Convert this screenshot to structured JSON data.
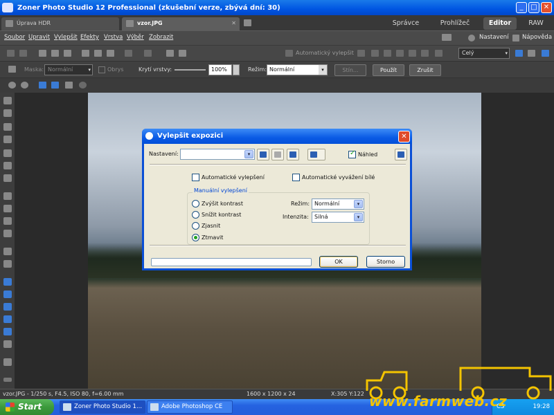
{
  "window": {
    "title": "Zoner Photo Studio 12 Professional (zkušební verze, zbývá dní: 30)",
    "minimize": "_",
    "maximize": "□",
    "close": "✕"
  },
  "tabs": [
    {
      "label": "Úprava HDR"
    },
    {
      "label": "vzor.JPG",
      "close": "✕"
    }
  ],
  "modes": {
    "manager": "Správce",
    "viewer": "Prohlížeč",
    "editor": "Editor",
    "raw": "RAW"
  },
  "menu": {
    "items": [
      "Soubor",
      "Upravit",
      "Vylepšit",
      "Efekty",
      "Vrstva",
      "Výběr",
      "Zobrazit"
    ],
    "settings": "Nastavení",
    "help": "Nápověda"
  },
  "toolbar1": {
    "auto_improve": "Automatický vylepšit",
    "zoom_select": "Celý",
    "zoom_arrow": "▾"
  },
  "toolbar2": {
    "mask_label": "Maska:",
    "mask_value": "Normální",
    "frame_label": "Obrys",
    "opacity_label": "Krytí vrstvy:",
    "opacity_value": "100%",
    "mode_label": "Režim:",
    "mode_value": "Normální",
    "shadow_btn": "Stín...",
    "apply_btn": "Použít",
    "cancel_btn": "Zrušit"
  },
  "dialog": {
    "title": "Vylepšit expozici",
    "close": "✕",
    "settings_label": "Nastavení:",
    "settings_value": "",
    "preview_label": "Náhled",
    "preview_checked": true,
    "auto_improve_label": "Automatické vylepšení",
    "auto_improve_checked": false,
    "auto_white_label": "Automatické vyvážení bílé",
    "auto_white_checked": false,
    "manual_group": "Manuální vylepšení",
    "radios": [
      {
        "label": "Zvýšit kontrast",
        "checked": false
      },
      {
        "label": "Snížit kontrast",
        "checked": false
      },
      {
        "label": "Zjasnit",
        "checked": false
      },
      {
        "label": "Ztmavit",
        "checked": true
      }
    ],
    "mode_label": "Režim:",
    "mode_value": "Normální",
    "intensity_label": "Intenzita:",
    "intensity_value": "Silná",
    "ok": "OK",
    "cancel": "Storno",
    "arrow": "▾"
  },
  "statusbar": {
    "info": "vzor.JPG - 1/250 s, F4.5, ISO 80, f=6.00 mm",
    "dimensions": "1600 x 1200 x 24",
    "coords": "X:305 Y:122"
  },
  "taskbar": {
    "start": "Start",
    "items": [
      "Zoner Photo Studio 1...",
      "Adobe Photoshop CE"
    ],
    "lang": "CS",
    "clock": "19:28"
  },
  "watermark": {
    "text": "www.farmweb.cz"
  },
  "colors": {
    "xp_blue": "#0a5ae5",
    "accent_green": "#21a121",
    "watermark_yellow": "#f4c400"
  }
}
